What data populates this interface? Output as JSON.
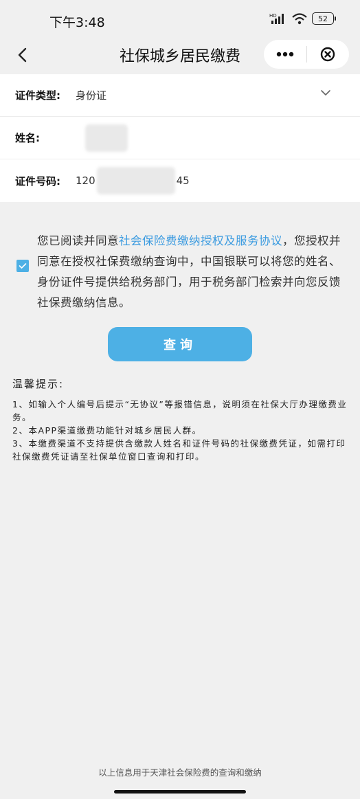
{
  "status_bar": {
    "time": "下午3:48",
    "battery": "52"
  },
  "nav": {
    "title": "社保城乡居民缴费"
  },
  "form": {
    "id_type": {
      "label": "证件类型:",
      "value": "身份证"
    },
    "name": {
      "label": "姓名:"
    },
    "id_number": {
      "label": "证件号码:",
      "prefix": "120",
      "suffix": "45"
    }
  },
  "agreement": {
    "text_before": "您已阅读并同意",
    "link": "社会保险费缴纳授权及服务协议",
    "text_after": "，您授权并同意在授权社保费缴纳查询中，中国银联可以将您的姓名、身份证件号提供给税务部门，用于税务部门检索并向您反馈社保费缴纳信息。",
    "checked": true
  },
  "query_button": "查询",
  "tips": {
    "title": "温馨提示:",
    "items": [
      "1、如输入个人编号后提示“无协议”等报错信息，说明须在社保大厅办理缴费业务。",
      "2、本APP渠道缴费功能针对城乡居民人群。",
      "3、本缴费渠道不支持提供含缴款人姓名和证件号码的社保缴费凭证，如需打印社保缴费凭证请至社保单位窗口查询和打印。"
    ]
  },
  "footer": "以上信息用于天津社会保险费的查询和缴纳",
  "colors": {
    "accent": "#4db0e5",
    "link": "#3b9be0",
    "background": "#f0f0f0"
  }
}
